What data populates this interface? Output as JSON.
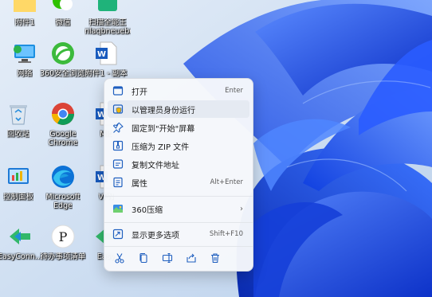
{
  "desktop": {
    "icons": [
      {
        "label": "附件1"
      },
      {
        "label": "微信"
      },
      {
        "label": "扫描全能王",
        "label2": "nlaqbneuebe"
      },
      {
        "label": "网络"
      },
      {
        "label": "360安全浏览器"
      },
      {
        "label": "附件1 - 副本"
      },
      {
        "label": "回收站"
      },
      {
        "label": "Google",
        "label2": "Chrome"
      },
      {
        "label": "Mic"
      },
      {
        "label": "控制面板"
      },
      {
        "label": "Microsoft",
        "label2": "Edge"
      },
      {
        "label": "VPN"
      },
      {
        "label": "EasyConn..."
      },
      {
        "label": "待办事项清单"
      },
      {
        "label": "Easy"
      }
    ]
  },
  "context_menu": {
    "items": [
      {
        "label": "打开",
        "shortcut": "Enter",
        "icon": "open-icon"
      },
      {
        "label": "以管理员身份运行",
        "shortcut": "",
        "icon": "shield-icon"
      },
      {
        "label": "固定到\"开始\"屏幕",
        "shortcut": "",
        "icon": "pin-icon"
      },
      {
        "label": "压缩为 ZIP 文件",
        "shortcut": "",
        "icon": "zip-icon"
      },
      {
        "label": "复制文件地址",
        "shortcut": "",
        "icon": "copy-path-icon"
      },
      {
        "label": "属性",
        "shortcut": "Alt+Enter",
        "icon": "properties-icon"
      },
      {
        "label": "360压缩",
        "arrow": "›",
        "icon": "360zip-icon"
      },
      {
        "label": "显示更多选项",
        "shortcut": "Shift+F10",
        "icon": "more-options-icon"
      }
    ],
    "actions": [
      "cut-icon",
      "copy-icon",
      "rename-icon",
      "share-icon",
      "delete-icon"
    ],
    "hover_index": 1
  },
  "colors": {
    "accent": "#0f6cbd",
    "wallpaper_light": "#dce9f5",
    "wallpaper_blue": "#1f5bf0"
  }
}
